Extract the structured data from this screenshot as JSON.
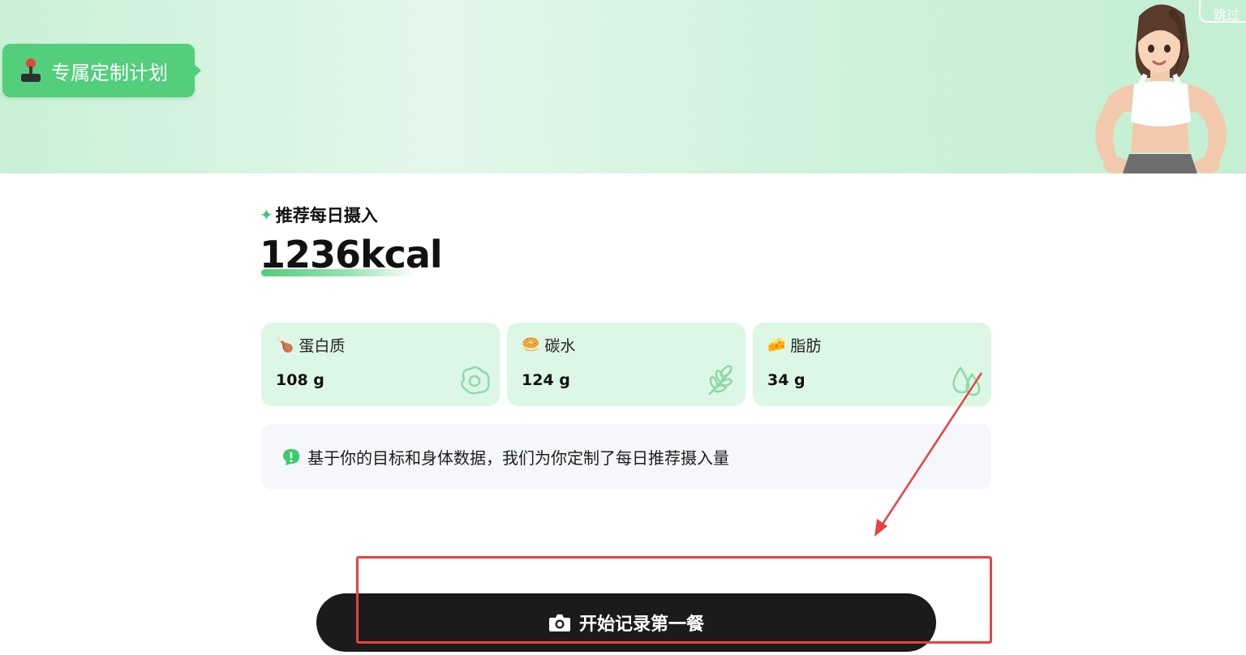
{
  "header": {
    "skip_label": "跳过",
    "plan_tag": {
      "label": "专属定制计划",
      "icon": "joystick-icon"
    },
    "avatar": "fitness-woman-avatar"
  },
  "recommendation": {
    "title": "推荐每日摄入",
    "title_icon": "sparkle-icon",
    "calories": "1236kcal"
  },
  "macros": [
    {
      "label": "蛋白质",
      "value": "108 g",
      "emoji": "🍗",
      "icon": "egg-icon"
    },
    {
      "label": "碳水",
      "value": "124 g",
      "emoji": "🥯",
      "icon": "wheat-icon"
    },
    {
      "label": "脂肪",
      "value": "34 g",
      "emoji": "🧀",
      "icon": "droplet-icon"
    }
  ],
  "notice": {
    "text": "基于你的目标和身体数据，我们为你定制了每日推荐摄入量",
    "icon": "exclamation-bubble-icon"
  },
  "cta": {
    "label": "开始记录第一餐",
    "icon": "camera-icon"
  },
  "colors": {
    "accent_green": "#53cf7c",
    "card_bg": "#dcf7e5",
    "button_bg": "#1b1b1b",
    "annotation_red": "#e84141"
  }
}
